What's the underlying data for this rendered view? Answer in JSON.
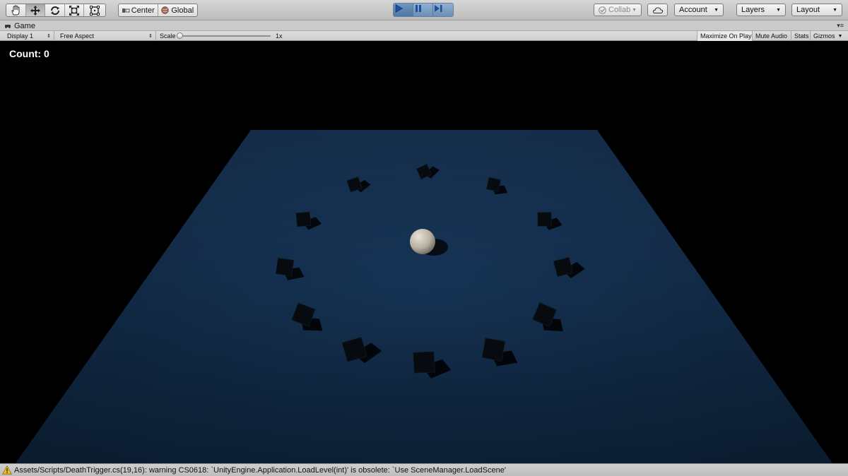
{
  "toolbar": {
    "tools": [
      {
        "name": "hand-tool",
        "icon": "hand-icon"
      },
      {
        "name": "move-tool",
        "icon": "move-icon"
      },
      {
        "name": "rotate-tool",
        "icon": "rotate-icon"
      },
      {
        "name": "scale-tool",
        "icon": "scale-icon"
      },
      {
        "name": "rect-tool",
        "icon": "rect-transform-icon"
      }
    ],
    "pivot_mode_label": "Center",
    "pivot_rotation_label": "Global",
    "collab_label": "Collab",
    "account_label": "Account",
    "layers_label": "Layers",
    "layout_label": "Layout",
    "play_accent": "#4f78a6"
  },
  "game_tab": {
    "title": "Game",
    "display_label": "Display 1",
    "aspect_label": "Free Aspect",
    "scale_label": "Scale",
    "scale_value": "1x",
    "maximize_label": "Maximize On Play",
    "mute_label": "Mute Audio",
    "stats_label": "Stats",
    "gizmos_label": "Gizmos"
  },
  "game_view": {
    "count_text": "Count: 0",
    "ground_color": "#16304d",
    "sky_color": "#000000",
    "player_color": "#d6cfc2",
    "pickup_count": 12
  },
  "status": {
    "message": "Assets/Scripts/DeathTrigger.cs(19,16): warning CS0618: `UnityEngine.Application.LoadLevel(int)' is obsolete: `Use SceneManager.LoadScene'"
  }
}
